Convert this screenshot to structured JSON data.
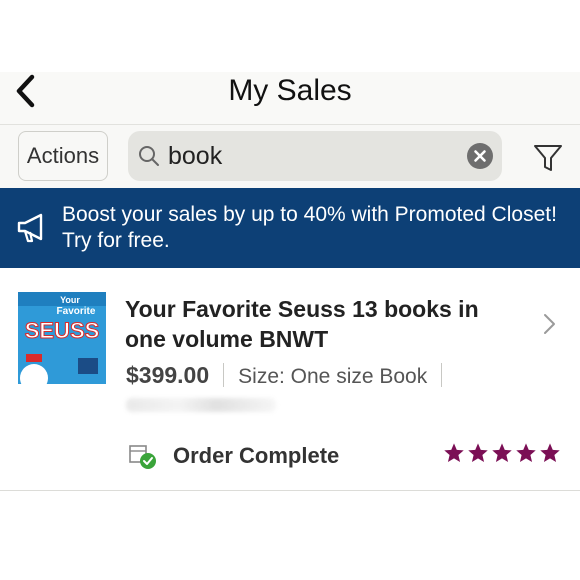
{
  "header": {
    "title": "My Sales",
    "back_icon": "chevron-left-icon"
  },
  "toolbar": {
    "actions_label": "Actions",
    "search": {
      "value": "book",
      "icon": "search-icon",
      "clear_icon": "close-icon"
    },
    "filter_icon": "filter-icon"
  },
  "promo": {
    "icon": "megaphone-icon",
    "text": "Boost your sales by up to 40% with Promoted Closet! Try for free.",
    "bg_color": "#0d4076"
  },
  "items": [
    {
      "title": "Your Favorite Seuss 13 books in one volume BNWT",
      "price": "$399.00",
      "size": "Size: One size Book",
      "status": "Order Complete",
      "rating": 5,
      "thumbnail_text": {
        "line1": "Your",
        "line2": "Favorite",
        "line3": "SEUSS"
      },
      "star_color": "#7b0f55",
      "check_color": "#3aa43a"
    }
  ]
}
